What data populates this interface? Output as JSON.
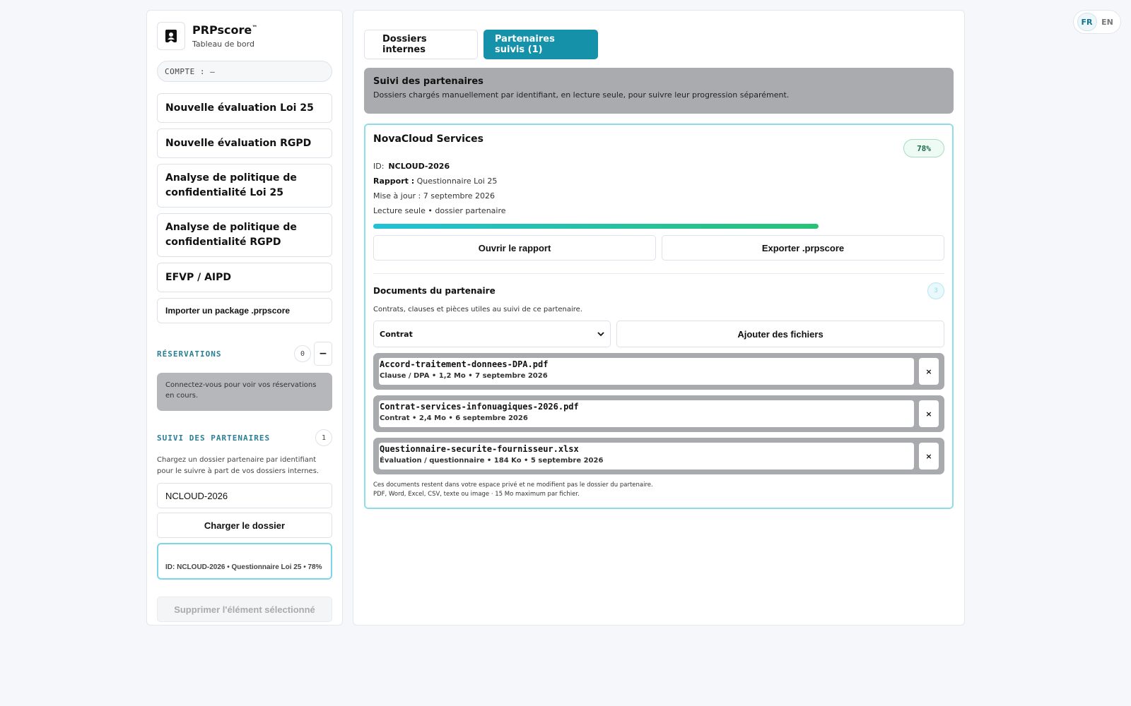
{
  "lang": {
    "fr": "FR",
    "en": "EN"
  },
  "brand": {
    "name": "PRPscore",
    "tm": "™",
    "subtitle": "Tableau de bord"
  },
  "account": {
    "label": "COMPTE : —"
  },
  "nav": [
    "Nouvelle évaluation Loi 25",
    "Nouvelle évaluation RGPD",
    "Analyse de politique de confidentialité Loi 25",
    "Analyse de politique de confidentialité RGPD",
    "EFVP / AIPD",
    "Importer un package .prpscore"
  ],
  "reservations": {
    "title": "RÉSERVATIONS",
    "count": "0",
    "collapse": "−",
    "notice": "Connectez-vous pour voir vos réservations en cours."
  },
  "partners": {
    "title": "SUIVI DES PARTENAIRES",
    "count": "1",
    "description": "Chargez un dossier partenaire par identifiant pour le suivre à part de vos dossiers internes.",
    "input_value": "NCLOUD-2026",
    "load_button": "Charger le dossier",
    "selected": "ID: NCLOUD-2026 • Questionnaire Loi 25 • 78%",
    "delete_button": "Supprimer l'élément sélectionné"
  },
  "tabs": {
    "internal": "Dossiers internes",
    "partners": "Partenaires suivis (1)"
  },
  "banner": {
    "title": "Suivi des partenaires",
    "subtitle": "Dossiers chargés manuellement par identifiant, en lecture seule, pour suivre leur progression séparément."
  },
  "card": {
    "name": "NovaCloud Services",
    "percent": "78%",
    "progress": 0.78,
    "id_label": "ID:",
    "id_value": "NCLOUD-2026",
    "report_label": "Rapport :",
    "report_value": "Questionnaire Loi 25",
    "updated": "Mise à jour : 7 septembre 2026",
    "access": "Lecture seule • dossier partenaire",
    "open_button": "Ouvrir le rapport",
    "export_button": "Exporter .prpscore"
  },
  "documents": {
    "title": "Documents du partenaire",
    "count": "3",
    "subtitle": "Contrats, clauses et pièces utiles au suivi de ce partenaire.",
    "select_value": "Contrat",
    "add_button": "Ajouter des fichiers",
    "remove_label": "×",
    "files": [
      {
        "name": "Accord-traitement-donnees-DPA.pdf",
        "meta": "Clause / DPA • 1,2 Mo • 7 septembre 2026"
      },
      {
        "name": "Contrat-services-infonuagiques-2026.pdf",
        "meta": "Contrat • 2,4 Mo • 6 septembre 2026"
      },
      {
        "name": "Questionnaire-securite-fournisseur.xlsx",
        "meta": "Évaluation / questionnaire • 184 Ko • 5 septembre 2026"
      }
    ],
    "footnote1": "Ces documents restent dans votre espace privé et ne modifient pas le dossier du partenaire.",
    "footnote2": "PDF, Word, Excel, CSV, texte ou image · 15 Mo maximum par fichier."
  }
}
